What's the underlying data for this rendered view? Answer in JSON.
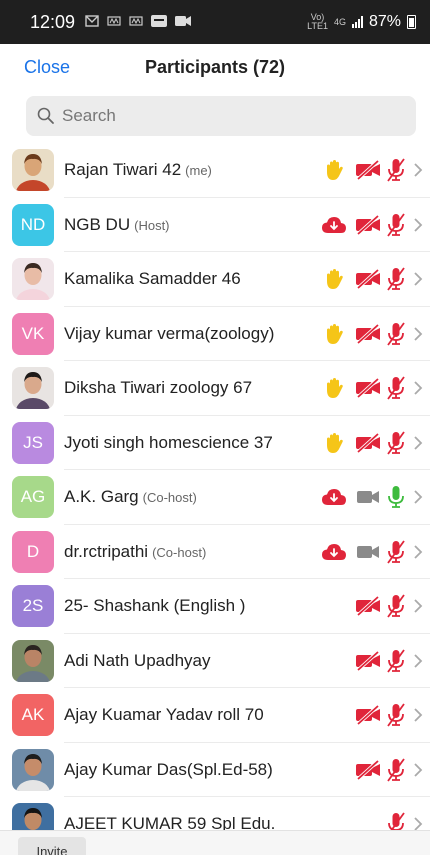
{
  "status_bar": {
    "time": "12:09",
    "battery": "87%",
    "network_top": "Vo)",
    "network_lte": "LTE1",
    "network_gen": "4G"
  },
  "header": {
    "close_label": "Close",
    "title": "Participants (72)"
  },
  "search": {
    "placeholder": "Search"
  },
  "participants": [
    {
      "name": "Rajan Tiwari 42",
      "role": "(me)",
      "avatar_type": "photo",
      "hand": true,
      "cloud": false,
      "video": "off",
      "mic": "off"
    },
    {
      "name": "NGB DU",
      "role": "(Host)",
      "avatar_type": "initials",
      "initials": "ND",
      "avatar_color": "#3cc6e6",
      "hand": false,
      "cloud": true,
      "video": "off",
      "mic": "off"
    },
    {
      "name": "Kamalika Samadder 46",
      "role": "",
      "avatar_type": "photo",
      "hand": true,
      "cloud": false,
      "video": "off",
      "mic": "off"
    },
    {
      "name": "Vijay kumar verma(zoology)",
      "role": "",
      "avatar_type": "initials",
      "initials": "VK",
      "avatar_color": "#ef7fb3",
      "hand": true,
      "cloud": false,
      "video": "off",
      "mic": "off"
    },
    {
      "name": "Diksha Tiwari zoology 67",
      "role": "",
      "avatar_type": "photo",
      "hand": true,
      "cloud": false,
      "video": "off",
      "mic": "off"
    },
    {
      "name": "Jyoti singh homescience 37",
      "role": "",
      "avatar_type": "initials",
      "initials": "JS",
      "avatar_color": "#b98ae0",
      "hand": true,
      "cloud": false,
      "video": "off",
      "mic": "off"
    },
    {
      "name": "A.K. Garg",
      "role": "(Co-host)",
      "avatar_type": "initials",
      "initials": "AG",
      "avatar_color": "#a7d98a",
      "hand": false,
      "cloud": true,
      "video": "gray",
      "mic": "on"
    },
    {
      "name": "dr.rctripathi",
      "role": "(Co-host)",
      "avatar_type": "initials",
      "initials": "D",
      "avatar_color": "#ef7fb3",
      "hand": false,
      "cloud": true,
      "video": "gray",
      "mic": "off"
    },
    {
      "name": "25- Shashank (English )",
      "role": "",
      "avatar_type": "initials",
      "initials": "2S",
      "avatar_color": "#9a7fd6",
      "hand": false,
      "cloud": false,
      "video": "off",
      "mic": "off"
    },
    {
      "name": "Adi Nath Upadhyay",
      "role": "",
      "avatar_type": "photo",
      "hand": false,
      "cloud": false,
      "video": "off",
      "mic": "off"
    },
    {
      "name": "Ajay Kuamar Yadav roll 70",
      "role": "",
      "avatar_type": "initials",
      "initials": "AK",
      "avatar_color": "#f26464",
      "hand": false,
      "cloud": false,
      "video": "off",
      "mic": "off"
    },
    {
      "name": "Ajay Kumar Das(Spl.Ed-58)",
      "role": "",
      "avatar_type": "photo",
      "hand": false,
      "cloud": false,
      "video": "off",
      "mic": "off"
    },
    {
      "name": "AJEET KUMAR 59 Spl Edu.",
      "role": "",
      "avatar_type": "photo",
      "hand": false,
      "cloud": false,
      "video": "none",
      "mic": "off"
    }
  ],
  "footer": {
    "invite_label": "Invite"
  },
  "colors": {
    "accent": "#1a73e8",
    "muted_red": "#e0253a",
    "hand_yellow": "#f5c518",
    "mic_on_green": "#3dbb3d",
    "gray_icon": "#8a8a8a"
  }
}
